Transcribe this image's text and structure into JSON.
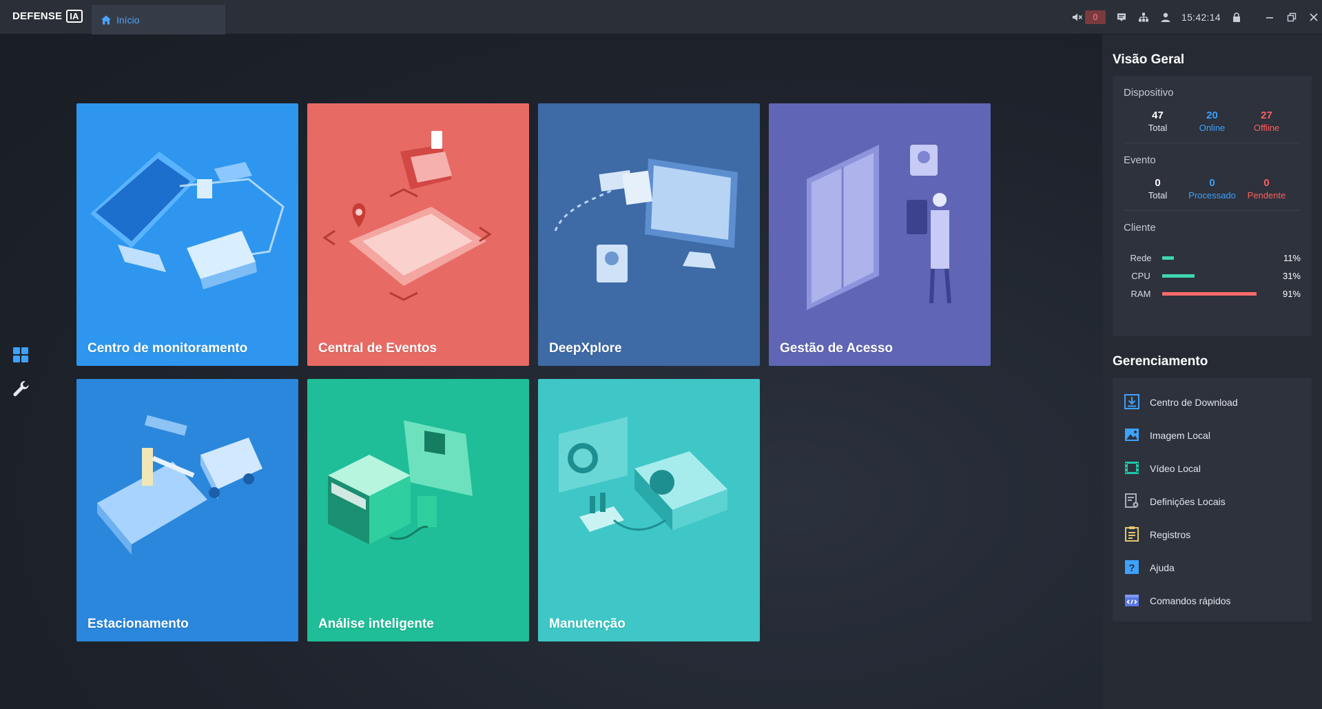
{
  "app": {
    "logo_text": "DEFENSE",
    "logo_badge": "IA"
  },
  "tabs": [
    {
      "label": "Início"
    }
  ],
  "topbar": {
    "alarm_count": "0",
    "time": "15:42:14"
  },
  "colors": {
    "accent": "#3ea2ff",
    "offline_red": "#ff5f5f",
    "net_bar": "#3fd6b0",
    "cpu_bar": "#3fd6b0",
    "ram_bar": "#ff6b6b"
  },
  "tiles": [
    {
      "label": "Centro de monitoramento"
    },
    {
      "label": "Central de Eventos"
    },
    {
      "label": "DeepXplore"
    },
    {
      "label": "Gestão de Acesso"
    },
    {
      "label": "Estacionamento"
    },
    {
      "label": "Análise inteligente"
    },
    {
      "label": "Manutenção"
    }
  ],
  "overview": {
    "title": "Visão Geral",
    "device": {
      "heading": "Dispositivo",
      "total": "47",
      "total_label": "Total",
      "online": "20",
      "online_label": "Online",
      "offline": "27",
      "offline_label": "Offline"
    },
    "event": {
      "heading": "Evento",
      "total": "0",
      "total_label": "Total",
      "processed": "0",
      "processed_label": "Processado",
      "pending": "0",
      "pending_label": "Pendente"
    },
    "client": {
      "heading": "Cliente",
      "resources": [
        {
          "name": "Rede",
          "percent": 11,
          "percent_text": "11%"
        },
        {
          "name": "CPU",
          "percent": 31,
          "percent_text": "31%"
        },
        {
          "name": "RAM",
          "percent": 91,
          "percent_text": "91%"
        }
      ]
    }
  },
  "management": {
    "title": "Gerenciamento",
    "items": [
      {
        "label": "Centro de Download",
        "icon": "download-icon"
      },
      {
        "label": "Imagem Local",
        "icon": "image-icon"
      },
      {
        "label": "Vídeo Local",
        "icon": "video-icon"
      },
      {
        "label": "Definições Locais",
        "icon": "settings-doc-icon"
      },
      {
        "label": "Registros",
        "icon": "log-icon"
      },
      {
        "label": "Ajuda",
        "icon": "help-icon"
      },
      {
        "label": "Comandos rápidos",
        "icon": "shortcut-icon"
      }
    ]
  }
}
